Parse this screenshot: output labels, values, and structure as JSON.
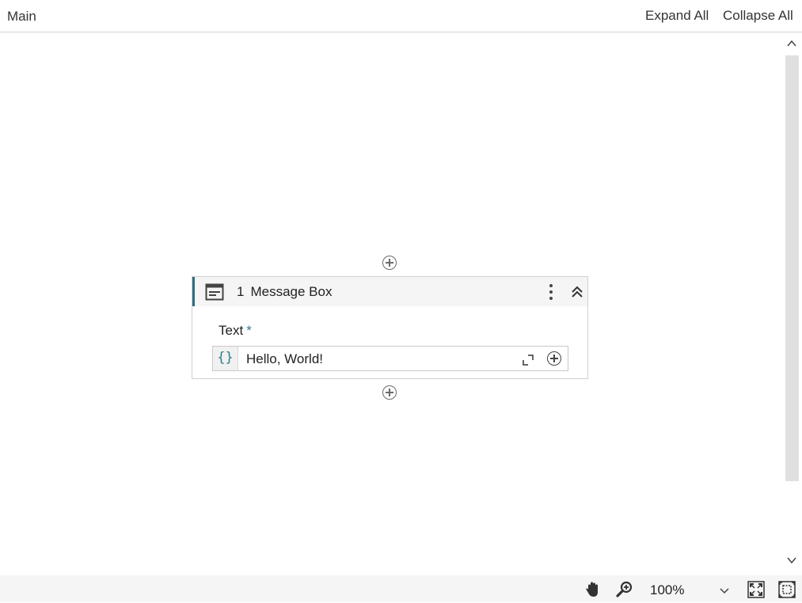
{
  "header": {
    "breadcrumb": "Main",
    "expand_all": "Expand All",
    "collapse_all": "Collapse All"
  },
  "activity": {
    "index": "1",
    "title": "Message Box",
    "field_label": "Text",
    "required_marker": "*",
    "expression_button": "{}",
    "text_value": "Hello, World!"
  },
  "statusbar": {
    "zoom": "100%"
  },
  "colors": {
    "accent": "#2f6d82",
    "required": "#2f7f8a"
  }
}
